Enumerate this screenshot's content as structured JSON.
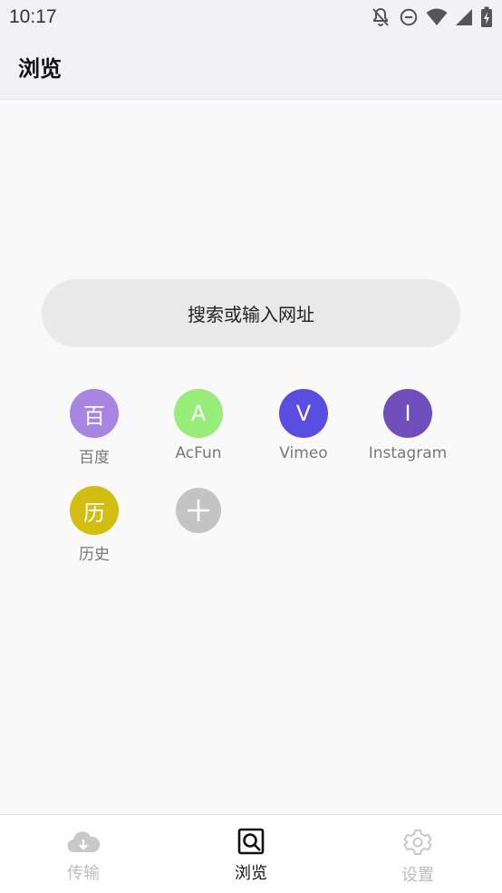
{
  "status_bar": {
    "time": "10:17",
    "icons": [
      "notifications-off-icon",
      "do-not-disturb-icon",
      "wifi-icon",
      "cellular-signal-icon",
      "battery-charging-icon"
    ]
  },
  "app_bar": {
    "title": "浏览"
  },
  "search": {
    "placeholder": "搜索或输入网址"
  },
  "sites": [
    {
      "icon_text": "百",
      "label": "百度",
      "color": "#a785e0"
    },
    {
      "icon_text": "A",
      "label": "AcFun",
      "color": "#98ec7a"
    },
    {
      "icon_text": "V",
      "label": "Vimeo",
      "color": "#5a4de2"
    },
    {
      "icon_text": "I",
      "label": "Instagram",
      "color": "#6e4fbc"
    },
    {
      "icon_text": "历",
      "label": "历史",
      "color": "#d2bd11"
    }
  ],
  "add_site": {
    "icon": "plus-icon",
    "color": "#c4c4c4"
  },
  "bottom_nav": {
    "items": [
      {
        "label": "传输",
        "icon": "cloud-download-icon",
        "active": false
      },
      {
        "label": "浏览",
        "icon": "browse-icon",
        "active": true
      },
      {
        "label": "设置",
        "icon": "gear-icon",
        "active": false
      }
    ]
  }
}
